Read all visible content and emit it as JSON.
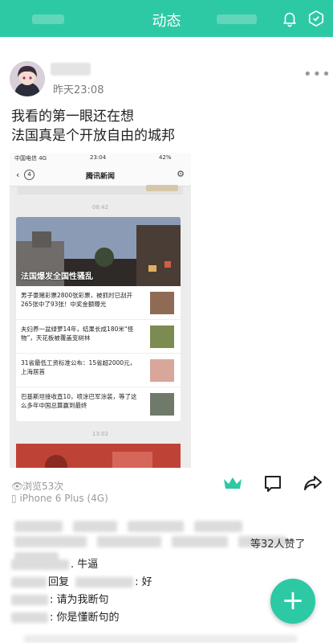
{
  "header": {
    "title": "动态",
    "bg_color": "#2dc9a5",
    "left_icon": "blurred-text",
    "right_icons": [
      "bell-icon",
      "hexagon-check-icon"
    ]
  },
  "post": {
    "time": "昨天23:08",
    "text_line1": "我看的第一眼还在想",
    "text_line2": "法国真是个开放自由的城邦",
    "more_label": "•••"
  },
  "screenshot": {
    "status_carrier": "中国电信 4G",
    "status_time": "23:04",
    "status_battery": "42%",
    "nav_badge": "4",
    "nav_title": "腾讯新闻",
    "time1": "08:42",
    "hero_caption": "法国爆发全国性骚乱",
    "rows": [
      "男子豪赌彩票2800张彩票，被抓时已刮开265张中了93张！中奖金额曝光",
      "夫妇养一盆绿萝14年，结果长成180米“怪物”，天花板被覆盖变树林",
      "31省最低工资标准公布：15省超2000元，上海居首",
      "巴基斯坦接收直10，喷涂巴军涂装，等了这么多年中国总算赢到最终"
    ],
    "time2": "13:02"
  },
  "meta": {
    "views": "浏览53次",
    "device": "iPhone 6 Plus (4G)"
  },
  "likes": {
    "suffix": "等32人赞了"
  },
  "comments": [
    {
      "text": ". 牛逼"
    },
    {
      "reply_word": "回复",
      "text": ": 好"
    },
    {
      "text": ": 请为我断句"
    },
    {
      "text": ": 你是懂断句的"
    }
  ],
  "fab": {
    "label": "+"
  },
  "colors": {
    "accent": "#2dc9a5",
    "muted": "#9a9a9a"
  }
}
